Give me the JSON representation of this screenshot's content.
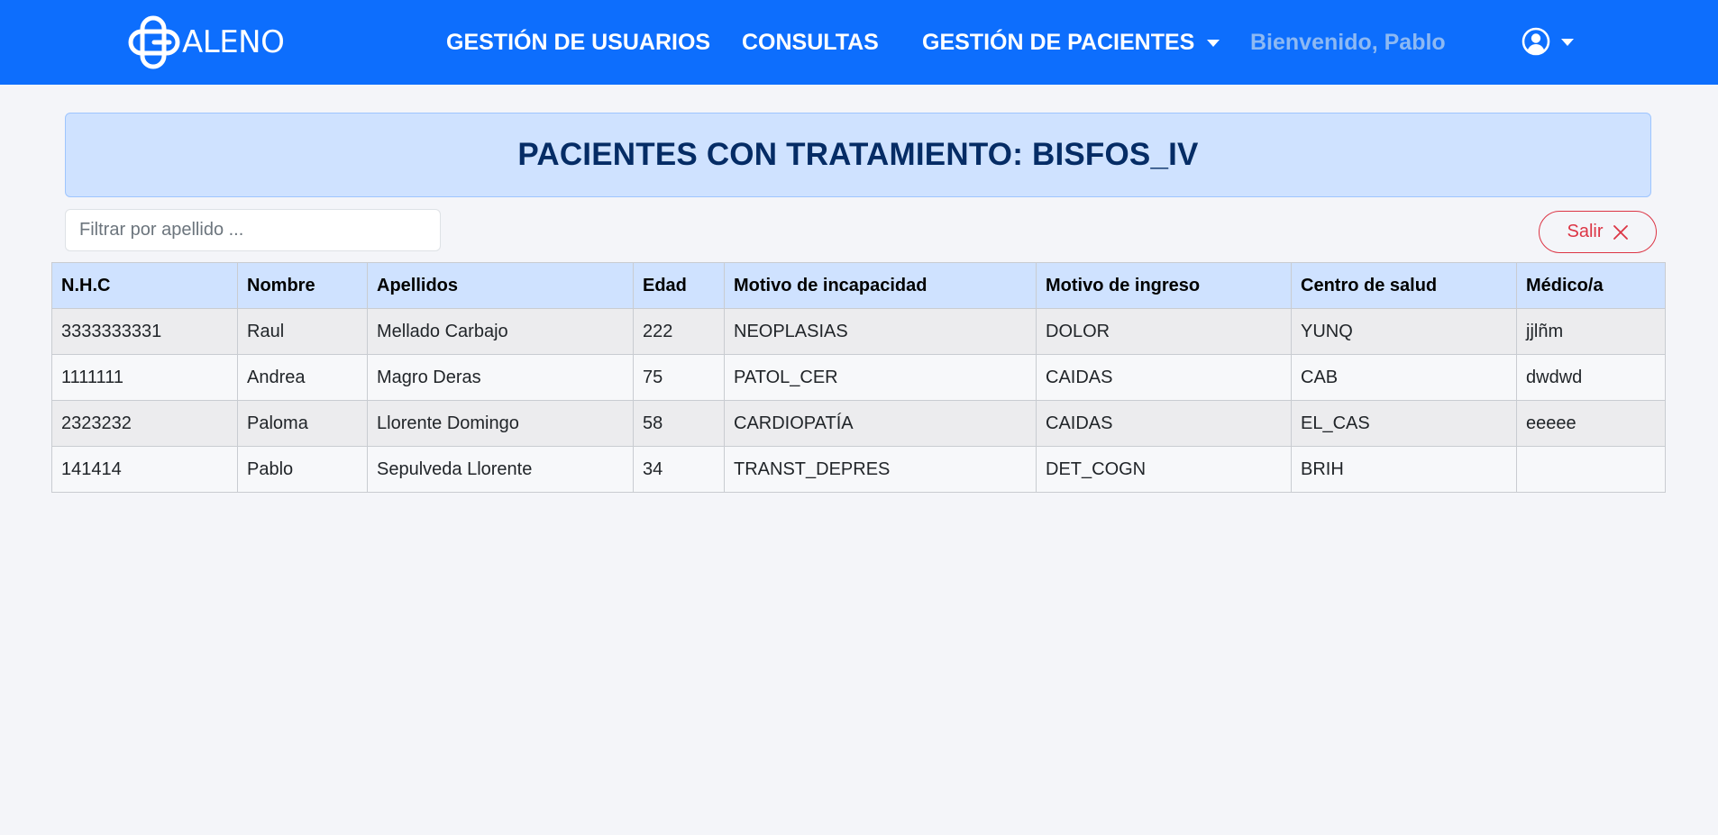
{
  "brand": {
    "logo_text": "ALENO",
    "colors": {
      "primary": "#0d6efd",
      "banner_bg": "#cfe2ff",
      "banner_text": "#052c65",
      "danger": "#dc3545",
      "welcome_text": "#8db9f3"
    }
  },
  "nav": {
    "items": [
      {
        "label": "GESTIÓN DE USUARIOS"
      },
      {
        "label": "CONSULTAS"
      },
      {
        "label": "GESTIÓN DE PACIENTES",
        "has_dropdown": true
      }
    ],
    "welcome": "Bienvenido, Pablo",
    "user_icon": "user-circle-icon"
  },
  "page": {
    "title": "PACIENTES CON TRATAMIENTO: BISFOS_IV",
    "filter": {
      "placeholder": "Filtrar por apellido ...",
      "value": ""
    },
    "exit_label": "Salir",
    "exit_icon": "close-icon"
  },
  "table": {
    "columns": [
      "N.H.C",
      "Nombre",
      "Apellidos",
      "Edad",
      "Motivo de incapacidad",
      "Motivo de ingreso",
      "Centro de salud",
      "Médico/a"
    ],
    "rows": [
      [
        "3333333331",
        "Raul",
        "Mellado Carbajo",
        "222",
        "NEOPLASIAS",
        "DOLOR",
        "YUNQ",
        "jjlñm"
      ],
      [
        "1111111",
        "Andrea",
        "Magro Deras",
        "75",
        "PATOL_CER",
        "CAIDAS",
        "CAB",
        "dwdwd"
      ],
      [
        "2323232",
        "Paloma",
        "Llorente Domingo",
        "58",
        "CARDIOPATÍA",
        "CAIDAS",
        "EL_CAS",
        "eeeee"
      ],
      [
        "141414",
        "Pablo",
        "Sepulveda Llorente",
        "34",
        "TRANST_DEPRES",
        "DET_COGN",
        "BRIH",
        ""
      ]
    ]
  }
}
